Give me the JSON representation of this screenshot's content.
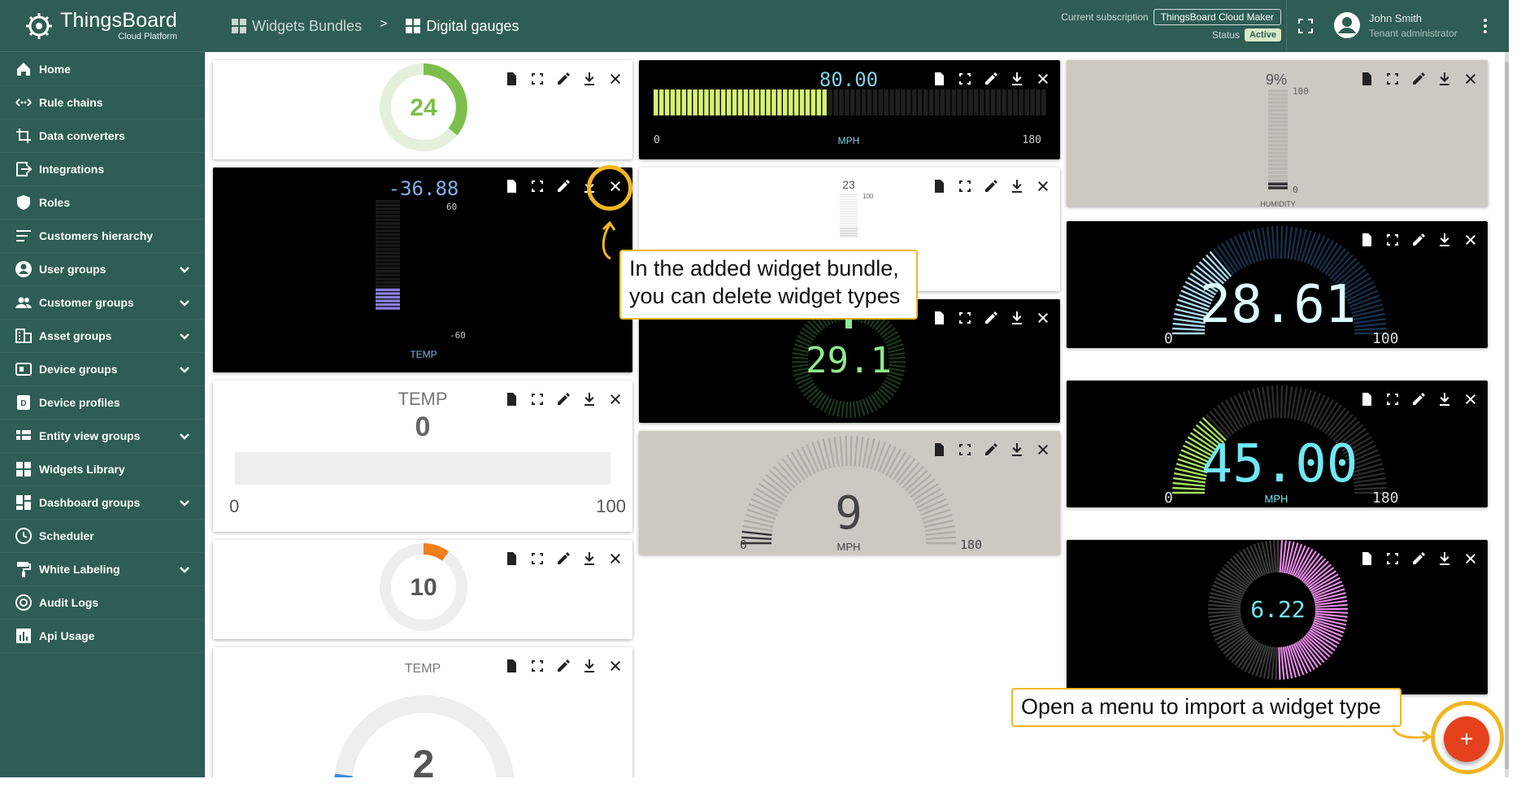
{
  "app": {
    "logo_title": "ThingsBoard",
    "logo_subtitle": "Cloud Platform"
  },
  "sidebar": {
    "items": [
      {
        "label": "Home",
        "icon": "home-icon",
        "expandable": false
      },
      {
        "label": "Rule chains",
        "icon": "rule-chains-icon",
        "expandable": false
      },
      {
        "label": "Data converters",
        "icon": "converter-icon",
        "expandable": false
      },
      {
        "label": "Integrations",
        "icon": "integrations-icon",
        "expandable": false
      },
      {
        "label": "Roles",
        "icon": "shield-icon",
        "expandable": false
      },
      {
        "label": "Customers hierarchy",
        "icon": "hierarchy-icon",
        "expandable": false
      },
      {
        "label": "User groups",
        "icon": "user-icon",
        "expandable": true
      },
      {
        "label": "Customer groups",
        "icon": "people-icon",
        "expandable": true
      },
      {
        "label": "Asset groups",
        "icon": "asset-icon",
        "expandable": true
      },
      {
        "label": "Device groups",
        "icon": "device-icon",
        "expandable": true
      },
      {
        "label": "Device profiles",
        "icon": "device-profile-icon",
        "expandable": false
      },
      {
        "label": "Entity view groups",
        "icon": "entity-view-icon",
        "expandable": true
      },
      {
        "label": "Widgets Library",
        "icon": "widgets-icon",
        "expandable": false
      },
      {
        "label": "Dashboard groups",
        "icon": "dashboard-icon",
        "expandable": true
      },
      {
        "label": "Scheduler",
        "icon": "clock-icon",
        "expandable": false
      },
      {
        "label": "White Labeling",
        "icon": "paint-roller-icon",
        "expandable": true
      },
      {
        "label": "Audit Logs",
        "icon": "audit-icon",
        "expandable": false
      },
      {
        "label": "Api Usage",
        "icon": "chart-icon",
        "expandable": false
      }
    ]
  },
  "header": {
    "breadcrumb_parent": "Widgets Bundles",
    "breadcrumb_separator": ">",
    "breadcrumb_current": "Digital gauges",
    "subscription_label": "Current subscription",
    "subscription_value": "ThingsBoard Cloud Maker",
    "status_label": "Status",
    "status_value": "Active",
    "user_name": "John Smith",
    "user_role": "Tenant administrator"
  },
  "widgets": {
    "w1": {
      "value": "24"
    },
    "w2": {
      "value": "-36.88",
      "max": "60",
      "min": "-60",
      "label": "TEMP"
    },
    "w3": {
      "title": "TEMP",
      "value": "0",
      "min": "0",
      "max": "100"
    },
    "w4": {
      "value": "10"
    },
    "w5": {
      "title": "TEMP",
      "value": "2"
    },
    "w6": {
      "value": "80.00",
      "min": "0",
      "max": "180",
      "label": "MPH"
    },
    "w7": {
      "value": "23",
      "max": "100"
    },
    "w8": {
      "value": "29.1"
    },
    "w9": {
      "value": "9",
      "min": "0",
      "max": "180",
      "label": "MPH"
    },
    "w10": {
      "value": "9%",
      "max": "100",
      "min": "0",
      "label": "HUMIDITY"
    },
    "w11": {
      "value": "28.61",
      "min": "0",
      "max": "100"
    },
    "w12": {
      "value": "45.00",
      "min": "0",
      "max": "180",
      "label": "MPH"
    },
    "w13": {
      "value": "6.22"
    }
  },
  "callouts": {
    "delete_tip": "In the added widget bundle,\nyou can delete widget types",
    "import_tip": "Open a menu to import a widget type"
  },
  "fab_label": "+"
}
